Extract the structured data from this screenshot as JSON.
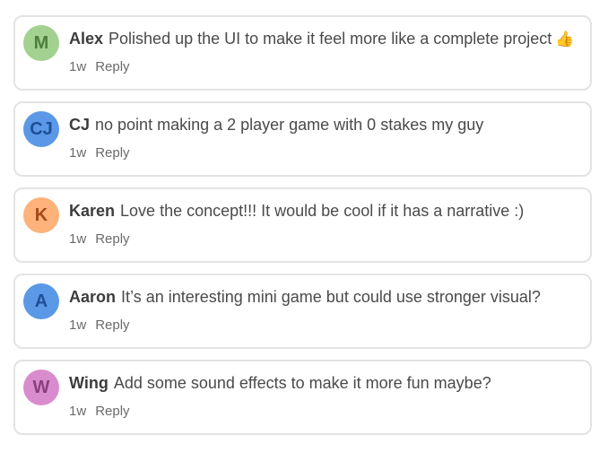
{
  "comments": [
    {
      "avatar_initial": "M",
      "avatar_bg": "#a3d18f",
      "avatar_fg": "#4c7f3b",
      "author": "Alex",
      "text": "Polished up the UI to make it feel more like a complete project",
      "emoji_icon": "thumbs-up-icon",
      "time": "1w",
      "reply_label": "Reply"
    },
    {
      "avatar_initial": "CJ",
      "avatar_bg": "#5b98e6",
      "avatar_fg": "#1f4f98",
      "author": "CJ",
      "text": "no point making a 2 player game with 0 stakes my guy",
      "time": "1w",
      "reply_label": "Reply"
    },
    {
      "avatar_initial": "K",
      "avatar_bg": "#ffb27a",
      "avatar_fg": "#a34a17",
      "author": "Karen",
      "text": "Love the concept!!! It would be cool if it has a narrative :)",
      "time": "1w",
      "reply_label": "Reply"
    },
    {
      "avatar_initial": "A",
      "avatar_bg": "#5b98e6",
      "avatar_fg": "#1f4f98",
      "author": "Aaron",
      "text": "It’s an interesting mini game but could use stronger visual?",
      "time": "1w",
      "reply_label": "Reply"
    },
    {
      "avatar_initial": "W",
      "avatar_bg": "#d98ccd",
      "avatar_fg": "#8a3f7f",
      "author": "Wing",
      "text": "Add some sound effects to make it more fun maybe?",
      "time": "1w",
      "reply_label": "Reply"
    }
  ]
}
